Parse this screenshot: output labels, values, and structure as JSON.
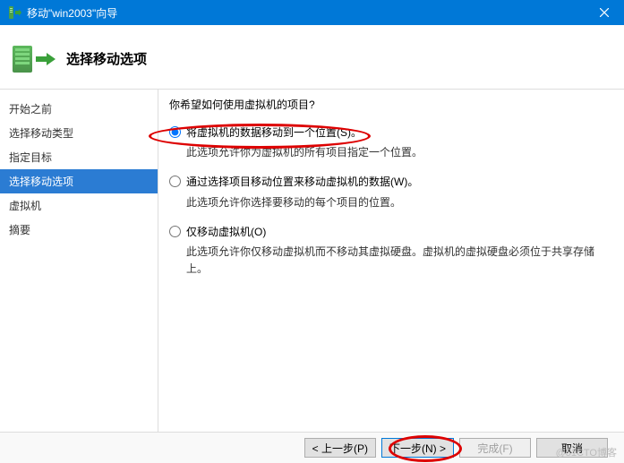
{
  "titlebar": {
    "title": "移动\"win2003\"向导"
  },
  "header": {
    "heading": "选择移动选项"
  },
  "sidebar": {
    "steps": [
      {
        "label": "开始之前",
        "active": false
      },
      {
        "label": "选择移动类型",
        "active": false
      },
      {
        "label": "指定目标",
        "active": false
      },
      {
        "label": "选择移动选项",
        "active": true
      },
      {
        "label": "虚拟机",
        "active": false
      },
      {
        "label": "摘要",
        "active": false
      }
    ]
  },
  "main": {
    "question": "你希望如何使用虚拟机的项目?",
    "options": [
      {
        "key": "move_all",
        "checked": true,
        "label": "将虚拟机的数据移动到一个位置(S)。",
        "desc": "此选项允许你为虚拟机的所有项目指定一个位置。"
      },
      {
        "key": "move_by_item",
        "checked": false,
        "label": "通过选择项目移动位置来移动虚拟机的数据(W)。",
        "desc": "此选项允许你选择要移动的每个项目的位置。"
      },
      {
        "key": "move_vm_only",
        "checked": false,
        "label": "仅移动虚拟机(O)",
        "desc": "此选项允许你仅移动虚拟机而不移动其虚拟硬盘。虚拟机的虚拟硬盘必须位于共享存储上。"
      }
    ]
  },
  "footer": {
    "prev": "< 上一步(P)",
    "next": "下一步(N) >",
    "finish": "完成(F)",
    "cancel": "取消"
  },
  "watermark": "@51CTO博客"
}
